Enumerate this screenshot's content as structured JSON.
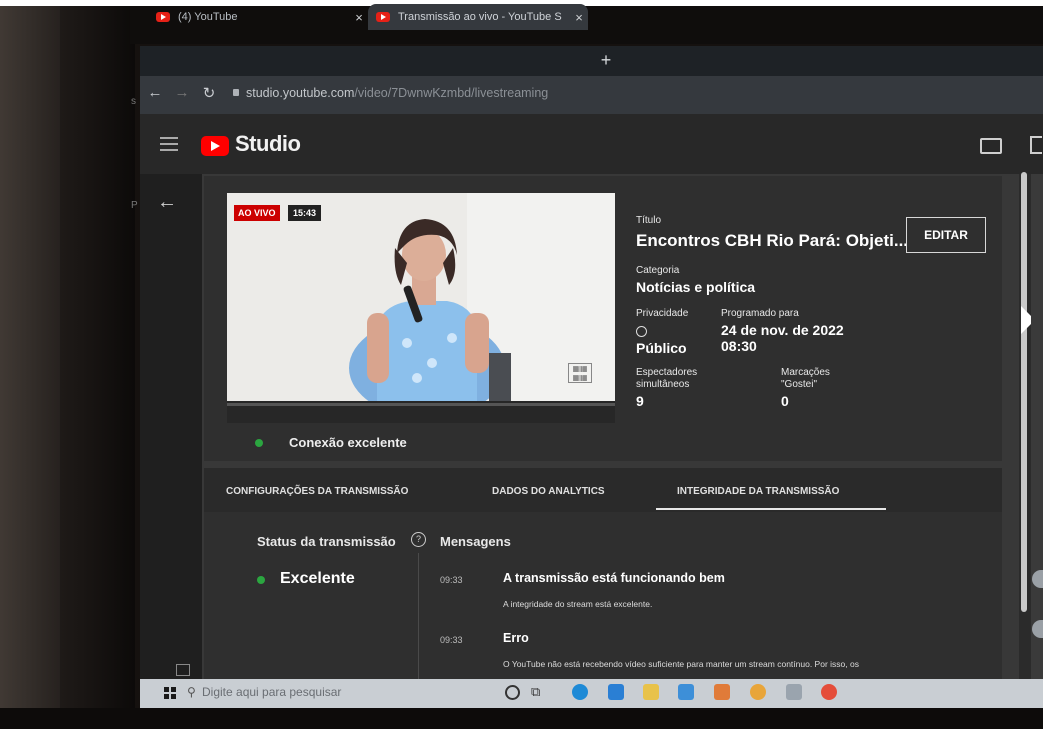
{
  "browser": {
    "tabs": [
      {
        "label": "(4) YouTube",
        "close": "×"
      },
      {
        "label": "Transmissão ao vivo - YouTube S",
        "close": "×"
      }
    ],
    "new_tab": "+",
    "url_host": "studio.youtube.com",
    "url_path": "/video/7DwnwKzmbd/livestreaming"
  },
  "header": {
    "logo_text": "Studio"
  },
  "video": {
    "live_badge": "AO VIVO",
    "elapsed": "15:43"
  },
  "details": {
    "title_label": "Título",
    "title_value": "Encontros CBH Rio Pará: Objeti...",
    "edit_button": "EDITAR",
    "category_label": "Categoria",
    "category_value": "Notícias e política",
    "privacy_label": "Privacidade",
    "privacy_value": "Público",
    "scheduled_label": "Programado para",
    "scheduled_date": "24 de nov. de 2022",
    "scheduled_time": "08:30",
    "viewers_label_1": "Espectadores",
    "viewers_label_2": "simultâneos",
    "viewers_value": "9",
    "likes_label_1": "Marcações",
    "likes_label_2": "\"Gostei\"",
    "likes_value": "0"
  },
  "connection": {
    "text": "Conexão excelente",
    "color": "#2ba640"
  },
  "tabs": [
    {
      "label": "CONFIGURAÇÕES DA TRANSMISSÃO",
      "active": false
    },
    {
      "label": "DADOS DO ANALYTICS",
      "active": false
    },
    {
      "label": "INTEGRIDADE DA TRANSMISSÃO",
      "active": true
    }
  ],
  "health": {
    "status_title": "Status da transmissão",
    "help": "?",
    "status_value": "Excelente",
    "messages_title": "Mensagens",
    "messages": [
      {
        "time": "09:33",
        "title": "A transmissão está funcionando bem",
        "body": "A integridade do stream está excelente."
      },
      {
        "time": "09:33",
        "title": "Erro",
        "body": "O YouTube não está recebendo vídeo suficiente para manter um stream contínuo. Por isso, os"
      }
    ]
  },
  "taskbar": {
    "search_placeholder": "Digite aqui para pesquisar"
  },
  "colors": {
    "accent_red": "#ff0000",
    "good_green": "#2ba640"
  }
}
